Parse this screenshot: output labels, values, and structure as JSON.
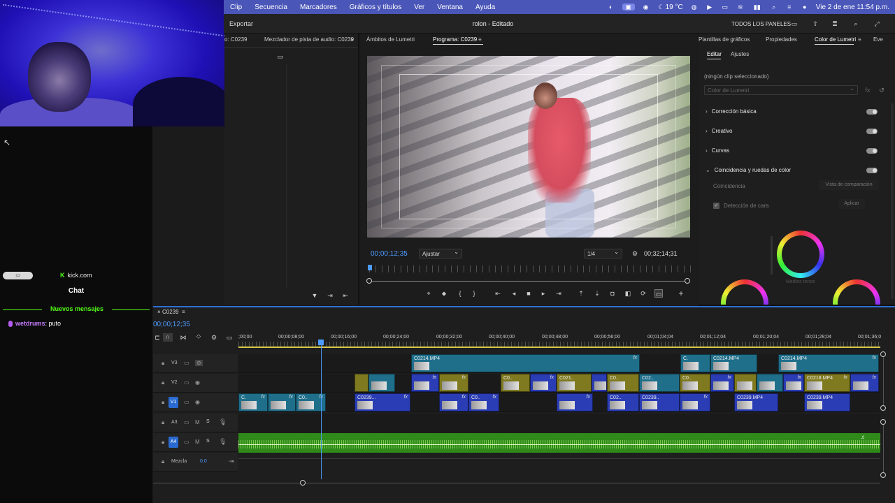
{
  "menubar": {
    "items": [
      "Clip",
      "Secuencia",
      "Marcadores",
      "Gráficos y títulos",
      "Ver",
      "Ventana",
      "Ayuda"
    ],
    "temperature": "19 °C",
    "datetime": "Vie 2 de ene  11:54 p.m."
  },
  "appbar": {
    "export_label": "Exportar",
    "title": "rolon - Editado",
    "all_panels": "TODOS LOS PANELES"
  },
  "chat": {
    "pill_label": "▭",
    "site": "kick.com",
    "title": "Chat",
    "new_messages": "Nuevos mensajes",
    "messages": [
      {
        "user": "wetdrums",
        "text": "puto"
      }
    ]
  },
  "source_panel": {
    "tab1": "o: C0239",
    "tab2": "Mezclador de pista de audio: C0239"
  },
  "program": {
    "tab_scopes": "Ámbitos de Lumetri",
    "tab_program": "Programa: C0239",
    "timecode": "00;00;12;35",
    "fit": "Ajustar",
    "resolution": "1/4",
    "duration": "00;32;14;31"
  },
  "lumetri": {
    "tabs": [
      "Plantillas de gráficos",
      "Propiedades",
      "Color de Lumetri",
      "Eve"
    ],
    "subtabs": [
      "Editar",
      "Ajustes"
    ],
    "no_clip": "(ningún clip seleccionado)",
    "preset_placeholder": "Color de Lumetri",
    "sections": [
      "Corrección básica",
      "Creativo",
      "Curvas",
      "Coincidencia y ruedas de color"
    ],
    "match_label": "Coincidencia",
    "compare_view": "Vista de comparación",
    "face_detect": "Detección de cara",
    "apply": "Aplicar",
    "midtones": "Medios tonos"
  },
  "timeline": {
    "sequence": "C0239",
    "timecode": "00;00;12;35",
    "ruler": [
      ";00;00",
      "00;00;08;00",
      "00;00;16;00",
      "00;00;24;00",
      "00;00;32;00",
      "00;00;40;00",
      "00;00;48;00",
      "00;00;56;00",
      "00;01;04;04",
      "00;01;12;04",
      "00;01;20;04",
      "00;01;28;04",
      "00;01;36;0"
    ],
    "tracks": {
      "v3": "V3",
      "v2": "V2",
      "v1": "V1",
      "a3": "A3",
      "a4": "A4",
      "mix": "Mezcla",
      "mix_value": "0.0",
      "m": "M",
      "s": "S"
    },
    "clip_labels": {
      "v3a": "C0214.MP4",
      "v3b": "C.",
      "v3c": "C0214.MP4",
      "v3d": "C0214.MP4",
      "v2a": "C0..",
      "v2b": "C021..",
      "v2c": "C0..",
      "v2d": "C02..",
      "v2e": "C0..",
      "v2f": "C0218.MP4",
      "v1a": "C.",
      "v1b": "C0..",
      "v1c": "C0239...",
      "v1d": "C0..",
      "v1e": "C02..",
      "v1f": "C0239..",
      "v1g": "C0239.MP4",
      "v1h": "C0239.MP4"
    },
    "fx_label": "fx"
  },
  "colors": {
    "menubar": "#4a56b8",
    "accent": "#2f6fd6",
    "kick_green": "#53fc18",
    "clip_teal": "#1f6f8b",
    "clip_blue": "#2a3db5",
    "clip_olive": "#7f7a1f",
    "audio_green": "#2f8a1a"
  }
}
